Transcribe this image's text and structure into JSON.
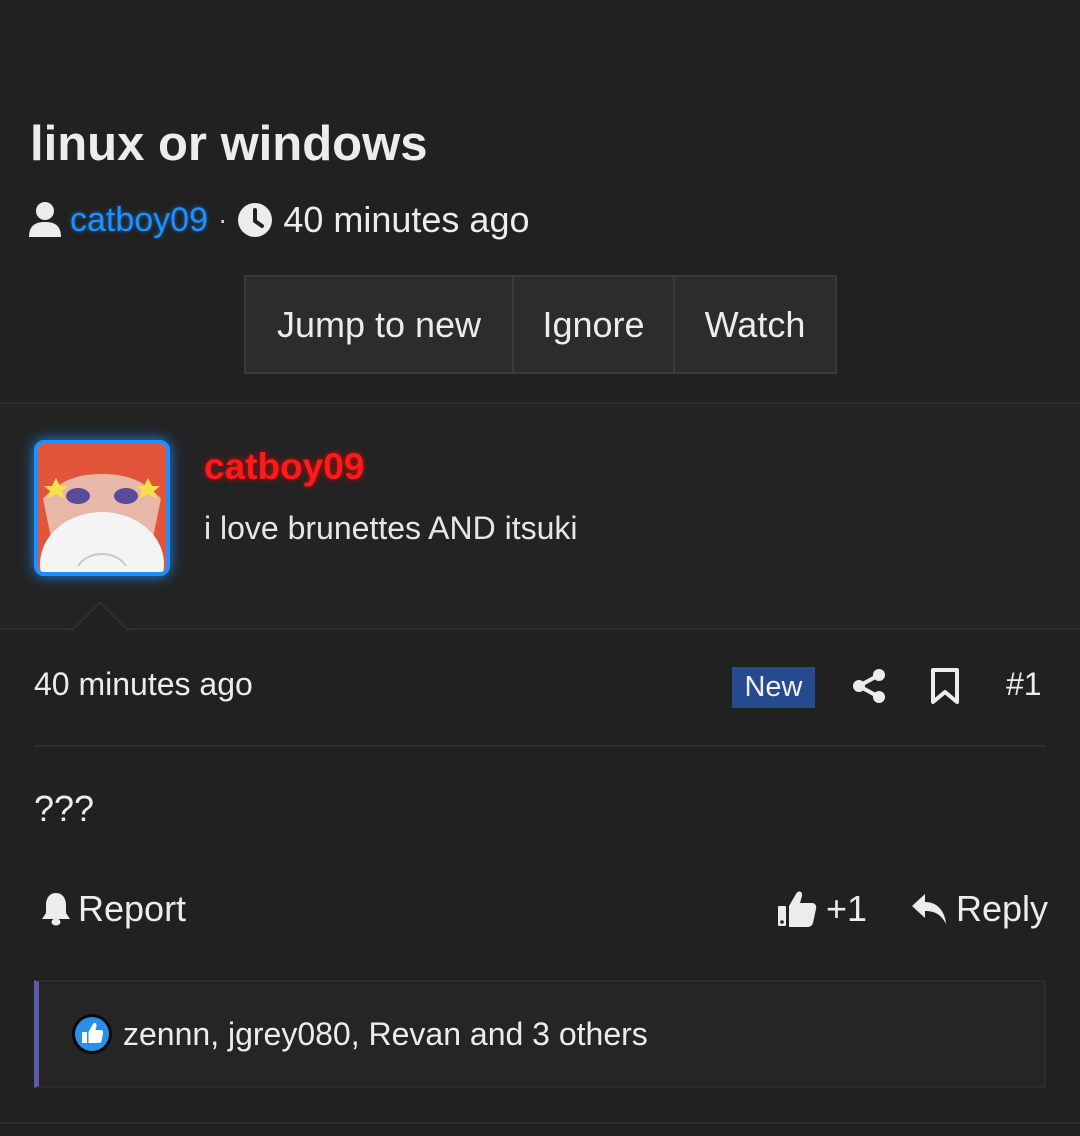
{
  "thread": {
    "title": "linux or windows",
    "author": "catboy09",
    "meta_separator": "·",
    "posted_time": "40 minutes ago"
  },
  "actions": {
    "jump_to_new": "Jump to new",
    "ignore": "Ignore",
    "watch": "Watch"
  },
  "post": {
    "username": "catboy09",
    "user_title": "i love brunettes AND itsuki",
    "time": "40 minutes ago",
    "badge": "New",
    "number": "#1",
    "body": "???",
    "report_label": "Report",
    "like_label": "+1",
    "reply_label": "Reply",
    "reactions_summary": "zennn, jgrey080, Revan and 3 others"
  },
  "colors": {
    "background": "#212121",
    "author_link": "#1e90ff",
    "username_red": "#ff1a1a",
    "badge_new_bg": "#264a8f",
    "reaction_accent": "#5a5ab0"
  },
  "icons": {
    "user": "user-icon",
    "clock": "clock-icon",
    "share": "share-icon",
    "bookmark": "bookmark-icon",
    "bell": "bell-icon",
    "thumb": "thumbs-up-icon",
    "reply": "reply-icon",
    "like_reaction": "like-reaction-icon"
  }
}
